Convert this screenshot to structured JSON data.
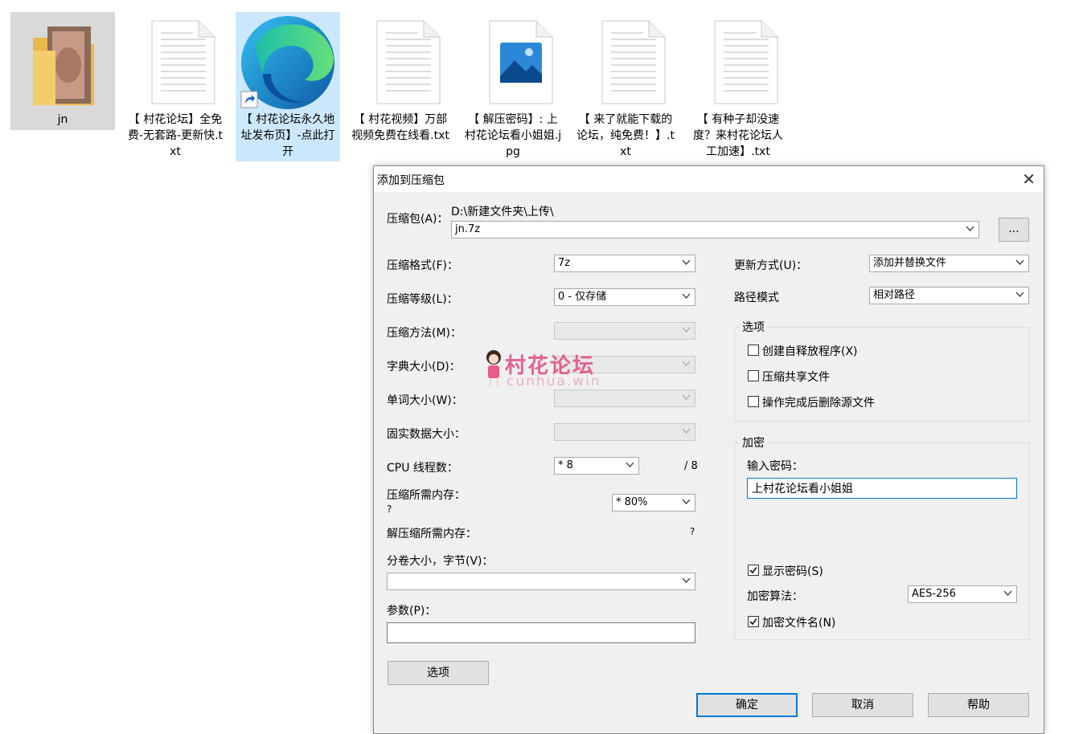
{
  "desktop": {
    "icons": [
      {
        "label": "jn"
      },
      {
        "label": "【 村花论坛】全免费-无套路-更新快.txt"
      },
      {
        "label": "【 村花论坛永久地址发布页】-点此打开"
      },
      {
        "label": "【 村花视频】万部视频免费在线看.txt"
      },
      {
        "label": "【 解压密码】: 上村花论坛看小姐姐.jpg"
      },
      {
        "label": "【 来了就能下载的论坛，纯免费！】.txt"
      },
      {
        "label": "【 有种子却没速度？来村花论坛人工加速】.txt"
      }
    ]
  },
  "watermark": {
    "title": "村花论坛",
    "subtitle": "cunhua.win"
  },
  "dialog": {
    "title": "添加到压缩包",
    "archive_label": "压缩包(A)：",
    "archive_path": "D:\\新建文件夹\\上传\\",
    "archive_name": "jn.7z",
    "browse_label": "...",
    "format_label": "压缩格式(F)：",
    "format_value": "7z",
    "level_label": "压缩等级(L)：",
    "level_value": "0 - 仅存储",
    "method_label": "压缩方法(M)：",
    "dict_label": "字典大小(D)：",
    "word_label": "单词大小(W)：",
    "solid_label": "固实数据大小：",
    "cpu_label": "CPU 线程数：",
    "cpu_value": "* 8",
    "cpu_total": "/ 8",
    "mem_label": "压缩所需内存：",
    "mem_q": "?",
    "mem_value": "* 80%",
    "decomp_label": "解压缩所需内存：",
    "decomp_q": "?",
    "volume_label": "分卷大小，字节(V)：",
    "params_label": "参数(P)：",
    "options_btn": "选项",
    "update_label": "更新方式(U)：",
    "update_value": "添加并替换文件",
    "path_label": "路径模式",
    "path_value": "相对路径",
    "options_group": "选项",
    "opt_sfx": "创建自释放程序(X)",
    "opt_shared": "压缩共享文件",
    "opt_delete": "操作完成后删除源文件",
    "enc_group": "加密",
    "pwd_label": "输入密码：",
    "pwd_value": "上村花论坛看小姐姐",
    "show_pwd": "显示密码(S)",
    "enc_alg_label": "加密算法：",
    "enc_alg_value": "AES-256",
    "enc_names": "加密文件名(N)",
    "ok": "确定",
    "cancel": "取消",
    "help": "帮助"
  }
}
